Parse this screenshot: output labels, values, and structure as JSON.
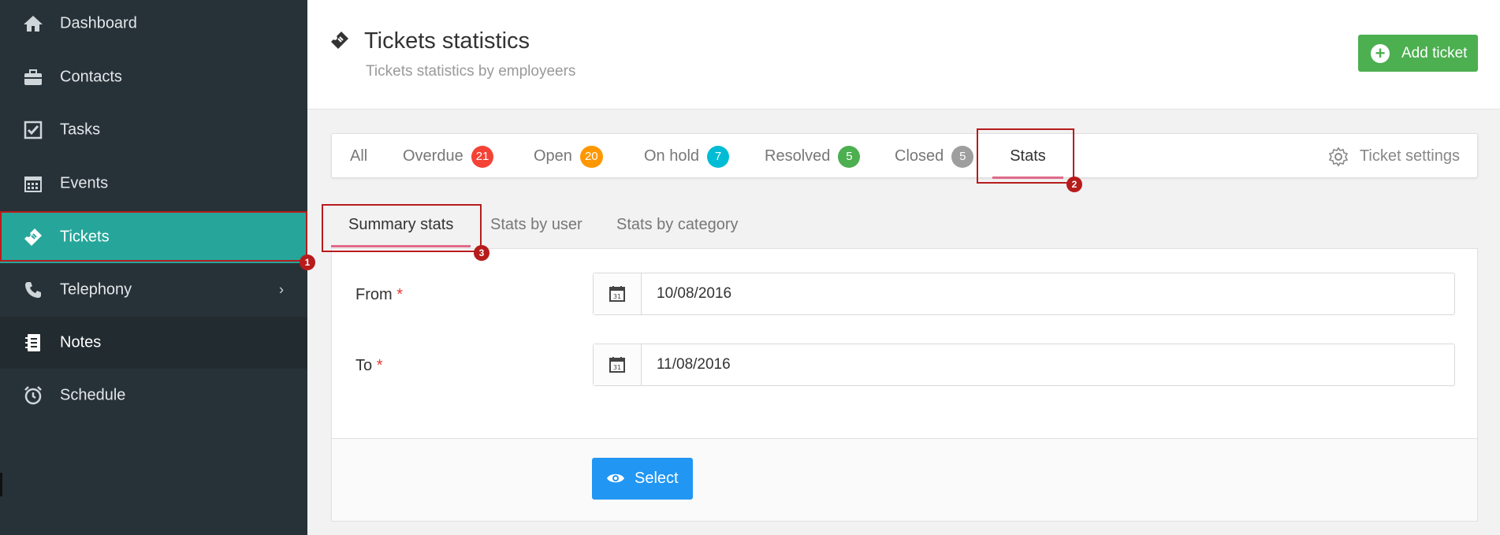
{
  "sidebar": {
    "items": [
      {
        "label": "Dashboard",
        "icon": "home-icon"
      },
      {
        "label": "Contacts",
        "icon": "briefcase-icon"
      },
      {
        "label": "Tasks",
        "icon": "checkbox-icon"
      },
      {
        "label": "Events",
        "icon": "calendar-icon"
      },
      {
        "label": "Tickets",
        "icon": "ticket-icon"
      },
      {
        "label": "Telephony",
        "icon": "phone-icon"
      },
      {
        "label": "Notes",
        "icon": "notebook-icon"
      },
      {
        "label": "Schedule",
        "icon": "alarm-clock-icon"
      }
    ],
    "active": "Tickets"
  },
  "header": {
    "title": "Tickets statistics",
    "subtitle": "Tickets statistics by employeers",
    "add_button": "Add ticket"
  },
  "tabs": [
    {
      "label": "All"
    },
    {
      "label": "Overdue",
      "count": "21",
      "color": "#f44336"
    },
    {
      "label": "Open",
      "count": "20",
      "color": "#ff9800"
    },
    {
      "label": "On hold",
      "count": "7",
      "color": "#00bcd4"
    },
    {
      "label": "Resolved",
      "count": "5",
      "color": "#4caf50"
    },
    {
      "label": "Closed",
      "count": "5",
      "color": "#9e9e9e"
    },
    {
      "label": "Stats"
    }
  ],
  "settings_label": "Ticket settings",
  "subtabs": [
    {
      "label": "Summary stats"
    },
    {
      "label": "Stats by user"
    },
    {
      "label": "Stats by category"
    }
  ],
  "form": {
    "from_label": "From",
    "from_value": "10/08/2016",
    "to_label": "To",
    "to_value": "11/08/2016",
    "required_mark": "*",
    "select_button": "Select"
  },
  "annotations": [
    "1",
    "2",
    "3"
  ],
  "colors": {
    "sidebar_bg": "#273238",
    "active_bg": "#26a69a",
    "accent_underline": "#e06a8a",
    "add_button": "#4caf50",
    "select_button": "#2196f3",
    "annotation": "#b71c1c"
  }
}
